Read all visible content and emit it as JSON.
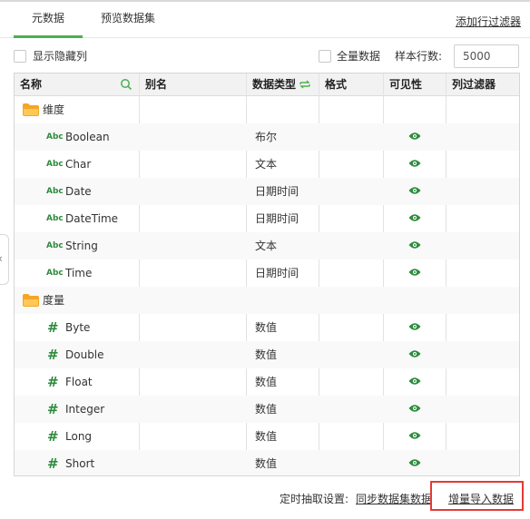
{
  "tabs": [
    {
      "label": "元数据",
      "active": true
    },
    {
      "label": "预览数据集",
      "active": false
    }
  ],
  "add_filter_label": "添加行过滤器",
  "options": {
    "show_hidden_label": "显示隐藏列",
    "full_data_label": "全量数据",
    "sample_rows_label": "样本行数:",
    "sample_rows_value": "5000"
  },
  "table": {
    "headers": {
      "name": "名称",
      "alias": "别名",
      "data_type": "数据类型",
      "format": "格式",
      "visibility": "可见性",
      "column_filter": "列过滤器"
    },
    "rows": [
      {
        "kind": "folder",
        "name": "维度"
      },
      {
        "kind": "text",
        "name": "Boolean",
        "type": "布尔",
        "visible": true
      },
      {
        "kind": "text",
        "name": "Char",
        "type": "文本",
        "visible": true
      },
      {
        "kind": "text",
        "name": "Date",
        "type": "日期时间",
        "visible": true
      },
      {
        "kind": "text",
        "name": "DateTime",
        "type": "日期时间",
        "visible": true
      },
      {
        "kind": "text",
        "name": "String",
        "type": "文本",
        "visible": true
      },
      {
        "kind": "text",
        "name": "Time",
        "type": "日期时间",
        "visible": true
      },
      {
        "kind": "folder",
        "name": "度量"
      },
      {
        "kind": "number",
        "name": "Byte",
        "type": "数值",
        "visible": true
      },
      {
        "kind": "number",
        "name": "Double",
        "type": "数值",
        "visible": true
      },
      {
        "kind": "number",
        "name": "Float",
        "type": "数值",
        "visible": true
      },
      {
        "kind": "number",
        "name": "Integer",
        "type": "数值",
        "visible": true
      },
      {
        "kind": "number",
        "name": "Long",
        "type": "数值",
        "visible": true
      },
      {
        "kind": "number",
        "name": "Short",
        "type": "数值",
        "visible": true
      }
    ],
    "text_icon_label": "Abc",
    "number_icon_label": "#"
  },
  "footer": {
    "schedule_label": "定时抽取设置:",
    "sync_link": "同步数据集数据",
    "batch_import_link": "增量导入数据"
  },
  "colors": {
    "accent": "#4caf50",
    "icon_green": "#2e8b3e",
    "folder": "#f5a623",
    "highlight_box": "#e53935"
  }
}
